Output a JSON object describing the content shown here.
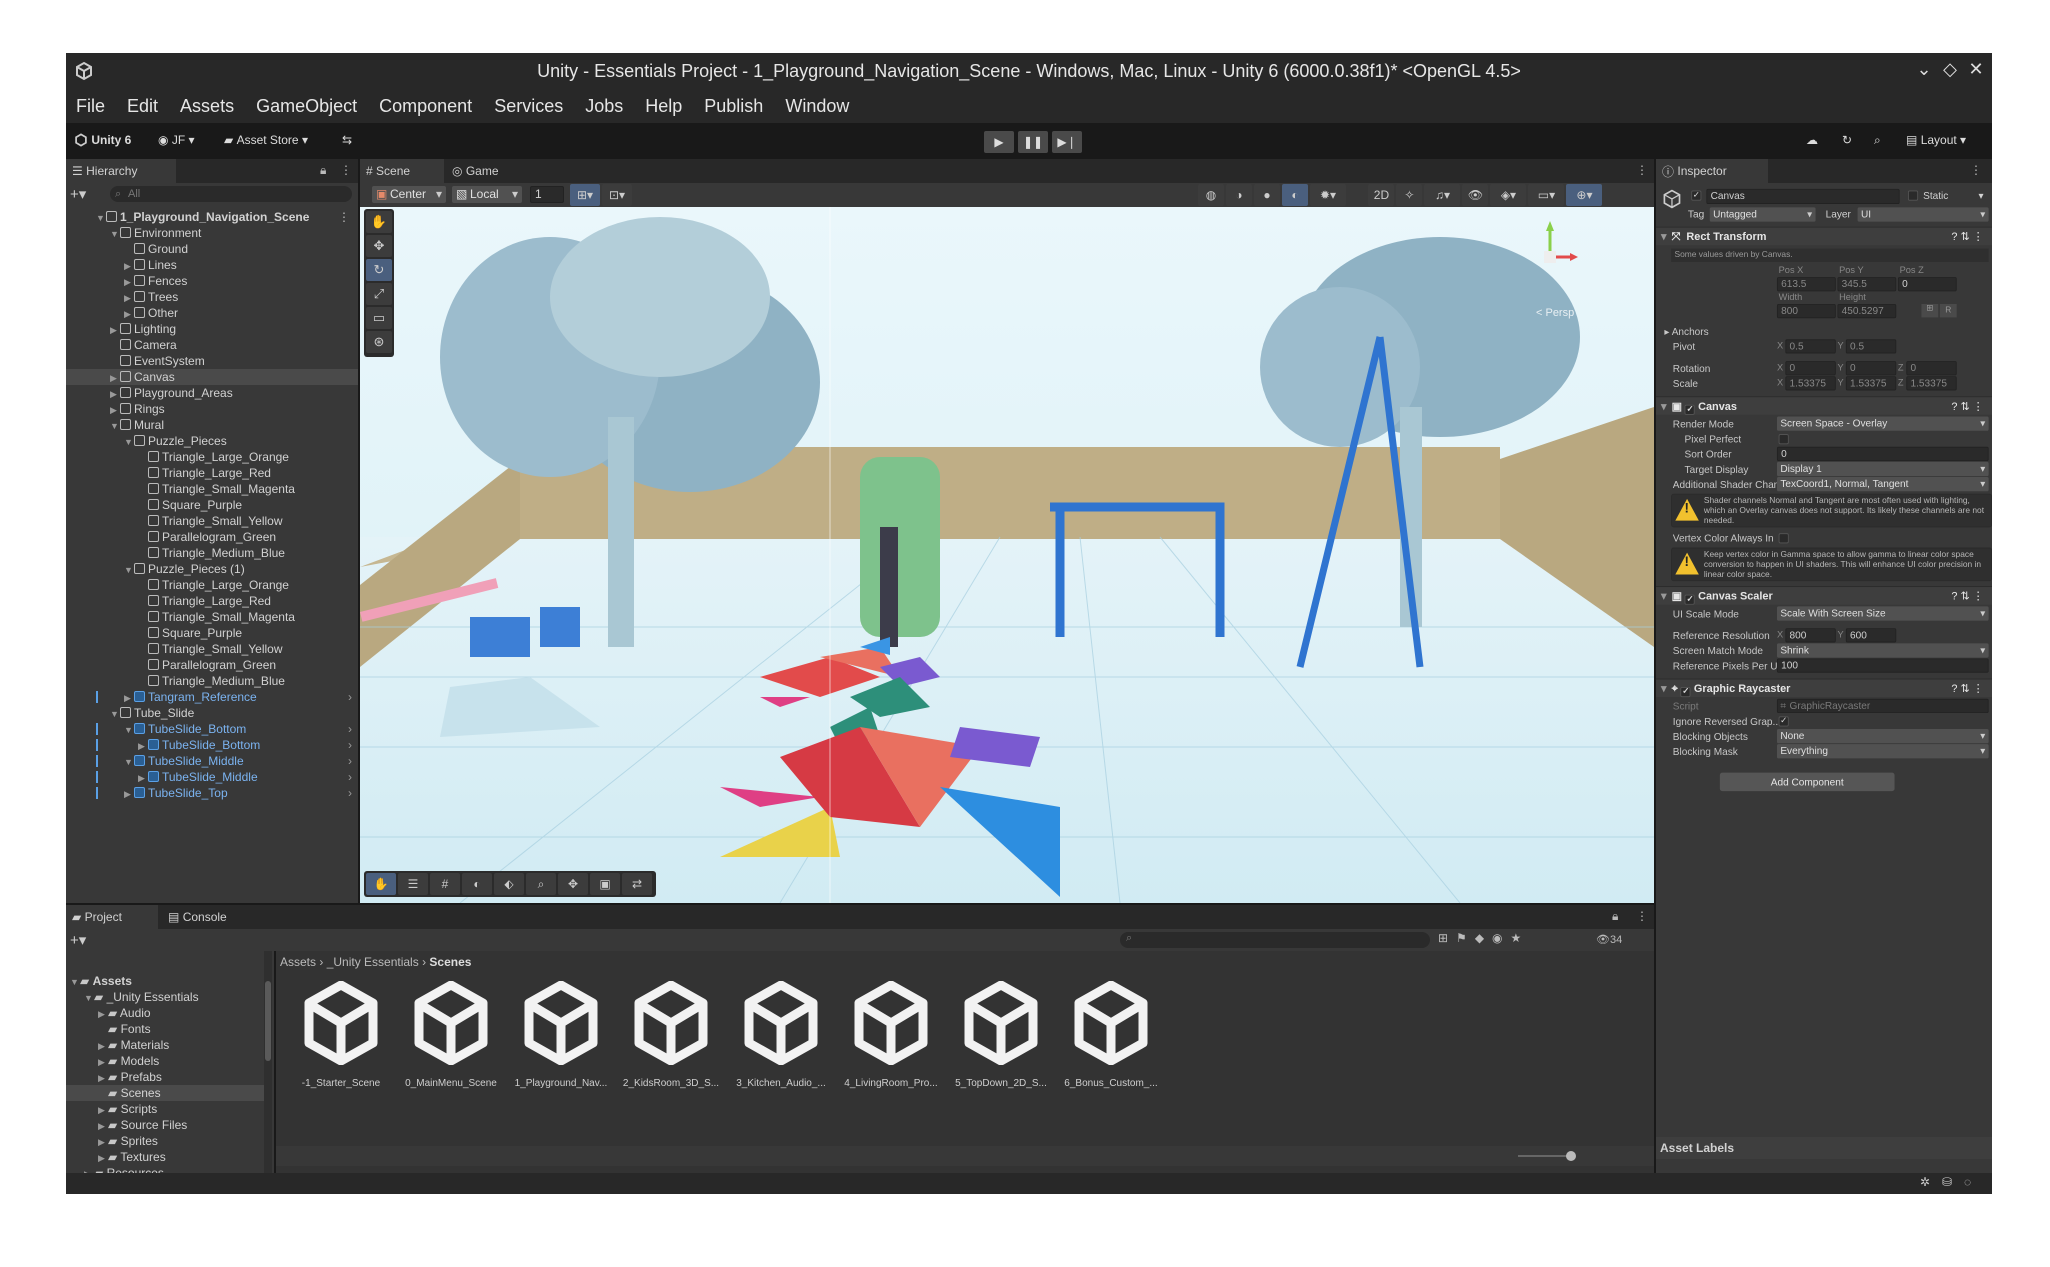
{
  "window": {
    "title": "Unity - Essentials Project - 1_Playground_Navigation_Scene - Windows, Mac, Linux - Unity 6 (6000.0.38f1)* <OpenGL 4.5>"
  },
  "menu": [
    "File",
    "Edit",
    "Assets",
    "GameObject",
    "Component",
    "Services",
    "Jobs",
    "Help",
    "Publish",
    "Window"
  ],
  "toolbar": {
    "account": "Unity 6",
    "user": "JF",
    "asset_store": "Asset Store",
    "layout": "Layout"
  },
  "hierarchy": {
    "tab": "Hierarchy",
    "search_placeholder": "All",
    "items": [
      {
        "label": "1_Playground_Navigation_Scene",
        "depth": 0,
        "arrow": "down",
        "bold": true
      },
      {
        "label": "Environment",
        "depth": 1,
        "arrow": "down"
      },
      {
        "label": "Ground",
        "depth": 2,
        "arrow": ""
      },
      {
        "label": "Lines",
        "depth": 2,
        "arrow": "right"
      },
      {
        "label": "Fences",
        "depth": 2,
        "arrow": "right"
      },
      {
        "label": "Trees",
        "depth": 2,
        "arrow": "right"
      },
      {
        "label": "Other",
        "depth": 2,
        "arrow": "right"
      },
      {
        "label": "Lighting",
        "depth": 1,
        "arrow": "right"
      },
      {
        "label": "Camera",
        "depth": 1,
        "arrow": ""
      },
      {
        "label": "EventSystem",
        "depth": 1,
        "arrow": ""
      },
      {
        "label": "Canvas",
        "depth": 1,
        "arrow": "right",
        "selected": true
      },
      {
        "label": "Playground_Areas",
        "depth": 1,
        "arrow": "right"
      },
      {
        "label": "Rings",
        "depth": 1,
        "arrow": "right"
      },
      {
        "label": "Mural",
        "depth": 1,
        "arrow": "down"
      },
      {
        "label": "Puzzle_Pieces",
        "depth": 2,
        "arrow": "down"
      },
      {
        "label": "Triangle_Large_Orange",
        "depth": 3,
        "arrow": ""
      },
      {
        "label": "Triangle_Large_Red",
        "depth": 3,
        "arrow": ""
      },
      {
        "label": "Triangle_Small_Magenta",
        "depth": 3,
        "arrow": ""
      },
      {
        "label": "Square_Purple",
        "depth": 3,
        "arrow": ""
      },
      {
        "label": "Triangle_Small_Yellow",
        "depth": 3,
        "arrow": ""
      },
      {
        "label": "Parallelogram_Green",
        "depth": 3,
        "arrow": ""
      },
      {
        "label": "Triangle_Medium_Blue",
        "depth": 3,
        "arrow": ""
      },
      {
        "label": "Puzzle_Pieces (1)",
        "depth": 2,
        "arrow": "down"
      },
      {
        "label": "Triangle_Large_Orange",
        "depth": 3,
        "arrow": ""
      },
      {
        "label": "Triangle_Large_Red",
        "depth": 3,
        "arrow": ""
      },
      {
        "label": "Triangle_Small_Magenta",
        "depth": 3,
        "arrow": ""
      },
      {
        "label": "Square_Purple",
        "depth": 3,
        "arrow": ""
      },
      {
        "label": "Triangle_Small_Yellow",
        "depth": 3,
        "arrow": ""
      },
      {
        "label": "Parallelogram_Green",
        "depth": 3,
        "arrow": ""
      },
      {
        "label": "Triangle_Medium_Blue",
        "depth": 3,
        "arrow": ""
      },
      {
        "label": "Tangram_Reference",
        "depth": 2,
        "arrow": "right",
        "prefab": true
      },
      {
        "label": "Tube_Slide",
        "depth": 1,
        "arrow": "down"
      },
      {
        "label": "TubeSlide_Bottom",
        "depth": 2,
        "arrow": "down",
        "prefab": true
      },
      {
        "label": "TubeSlide_Bottom",
        "depth": 3,
        "arrow": "right",
        "prefab": true
      },
      {
        "label": "TubeSlide_Middle",
        "depth": 2,
        "arrow": "down",
        "prefab": true
      },
      {
        "label": "TubeSlide_Middle",
        "depth": 3,
        "arrow": "right",
        "prefab": true
      },
      {
        "label": "TubeSlide_Top",
        "depth": 2,
        "arrow": "right",
        "prefab": true
      }
    ]
  },
  "scene": {
    "tab_scene": "Scene",
    "tab_game": "Game",
    "pivot": "Center",
    "space": "Local",
    "grid_value": "1",
    "persp": "< Persp"
  },
  "inspector": {
    "tab": "Inspector",
    "object_name": "Canvas",
    "static": "Static",
    "tag_label": "Tag",
    "tag": "Untagged",
    "layer_label": "Layer",
    "layer": "UI",
    "rect": {
      "title": "Rect Transform",
      "note": "Some values driven by Canvas.",
      "posx_l": "Pos X",
      "posy_l": "Pos Y",
      "posz_l": "Pos Z",
      "posx": "613.5",
      "posy": "345.5",
      "posz": "0",
      "width_l": "Width",
      "height_l": "Height",
      "width": "800",
      "height": "450.5297",
      "anchors": "Anchors",
      "pivot": "Pivot",
      "pivot_x": "0.5",
      "pivot_y": "0.5",
      "rotation": "Rotation",
      "rot_x": "0",
      "rot_y": "0",
      "rot_z": "0",
      "scale": "Scale",
      "sc_x": "1.53375",
      "sc_y": "1.53375",
      "sc_z": "1.53375",
      "x": "X",
      "y": "Y",
      "z": "Z",
      "r": "R"
    },
    "canvas": {
      "title": "Canvas",
      "render_mode_l": "Render Mode",
      "render_mode": "Screen Space - Overlay",
      "pixel_perfect": "Pixel Perfect",
      "sort_order_l": "Sort Order",
      "sort_order": "0",
      "target_display_l": "Target Display",
      "target_display": "Display 1",
      "shader_l": "Additional Shader Chann",
      "shader": "TexCoord1, Normal, Tangent",
      "warn1": "Shader channels Normal and Tangent are most often used with lighting, which an Overlay canvas does not support. Its likely these channels are not needed.",
      "vertex_l": "Vertex Color Always In G",
      "warn2": "Keep vertex color in Gamma space to allow gamma to linear color space conversion to happen in UI shaders. This will enhance UI color precision in linear color space."
    },
    "scaler": {
      "title": "Canvas Scaler",
      "scale_mode_l": "UI Scale Mode",
      "scale_mode": "Scale With Screen Size",
      "ref_res_l": "Reference Resolution",
      "ref_x": "800",
      "ref_y": "600",
      "match_l": "Screen Match Mode",
      "match": "Shrink",
      "ppu_l": "Reference Pixels Per Uni",
      "ppu": "100"
    },
    "raycaster": {
      "title": "Graphic Raycaster",
      "script_l": "Script",
      "script": "GraphicRaycaster",
      "ignore_l": "Ignore Reversed Grap...",
      "blocking_l": "Blocking Objects",
      "blocking": "None",
      "mask_l": "Blocking Mask",
      "mask": "Everything"
    },
    "add_component": "Add Component",
    "asset_labels": "Asset Labels"
  },
  "project": {
    "tab_project": "Project",
    "tab_console": "Console",
    "breadcrumb": [
      "Assets",
      "_Unity Essentials",
      "Scenes"
    ],
    "count": "34",
    "tree": [
      {
        "label": "Assets",
        "depth": 0,
        "arrow": "down",
        "bold": true
      },
      {
        "label": "_Unity Essentials",
        "depth": 1,
        "arrow": "down"
      },
      {
        "label": "Audio",
        "depth": 2,
        "arrow": "right"
      },
      {
        "label": "Fonts",
        "depth": 2,
        "arrow": ""
      },
      {
        "label": "Materials",
        "depth": 2,
        "arrow": "right"
      },
      {
        "label": "Models",
        "depth": 2,
        "arrow": "right"
      },
      {
        "label": "Prefabs",
        "depth": 2,
        "arrow": "right"
      },
      {
        "label": "Scenes",
        "depth": 2,
        "arrow": "",
        "selected": true
      },
      {
        "label": "Scripts",
        "depth": 2,
        "arrow": "right"
      },
      {
        "label": "Source Files",
        "depth": 2,
        "arrow": "right"
      },
      {
        "label": "Sprites",
        "depth": 2,
        "arrow": "right"
      },
      {
        "label": "Textures",
        "depth": 2,
        "arrow": "right"
      },
      {
        "label": "Resources",
        "depth": 1,
        "arrow": "right"
      }
    ],
    "assets": [
      "-1_Starter_Scene",
      "0_MainMenu_Scene",
      "1_Playground_Nav...",
      "2_KidsRoom_3D_S...",
      "3_Kitchen_Audio_...",
      "4_LivingRoom_Pro...",
      "5_TopDown_2D_S...",
      "6_Bonus_Custom_..."
    ]
  }
}
